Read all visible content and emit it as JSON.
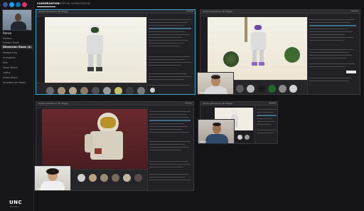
{
  "app": {
    "self_name": "Renzo",
    "logo": "UNC",
    "logo_sub": "STUDIO"
  },
  "top_icons": [
    {
      "name": "facebook-icon",
      "color": "#3b5998"
    },
    {
      "name": "twitter-icon",
      "color": "#1da1f2"
    },
    {
      "name": "linkedin-icon",
      "color": "#0077b5"
    },
    {
      "name": "instagram-icon",
      "color": "#e1306c"
    }
  ],
  "tabs": [
    {
      "label": "CONVERSATION",
      "active": true
    },
    {
      "label": "VIRTUAL WORKSTATION",
      "active": false
    }
  ],
  "sidebar": {
    "items": [
      {
        "label": "Rooms",
        "active": false
      },
      {
        "label": "Stream Team",
        "active": false
      },
      {
        "label": "Dimension Room (4)",
        "active": true
      },
      {
        "label": "Networking",
        "active": false
      },
      {
        "label": "Animation",
        "active": false
      },
      {
        "label": "Dev",
        "active": false
      },
      {
        "label": "Team Match",
        "active": false
      },
      {
        "label": "Lobby",
        "active": false
      },
      {
        "label": "Video Room",
        "active": false
      },
      {
        "label": "Architecture Room",
        "active": false
      }
    ]
  },
  "participants": [
    {
      "name": "Jason"
    },
    {
      "name": "Mark"
    },
    {
      "name": "Mila"
    }
  ],
  "windows": [
    {
      "title": "Adobe Substance 3D Stager"
    },
    {
      "title": "Adobe Substance 3D Stager"
    },
    {
      "title": "Adobe Substance 3D Stager"
    },
    {
      "title": "Adobe Substance 3D Stager"
    }
  ],
  "colors": {
    "selected_border": "#3aa8c8",
    "background": "#141416"
  }
}
